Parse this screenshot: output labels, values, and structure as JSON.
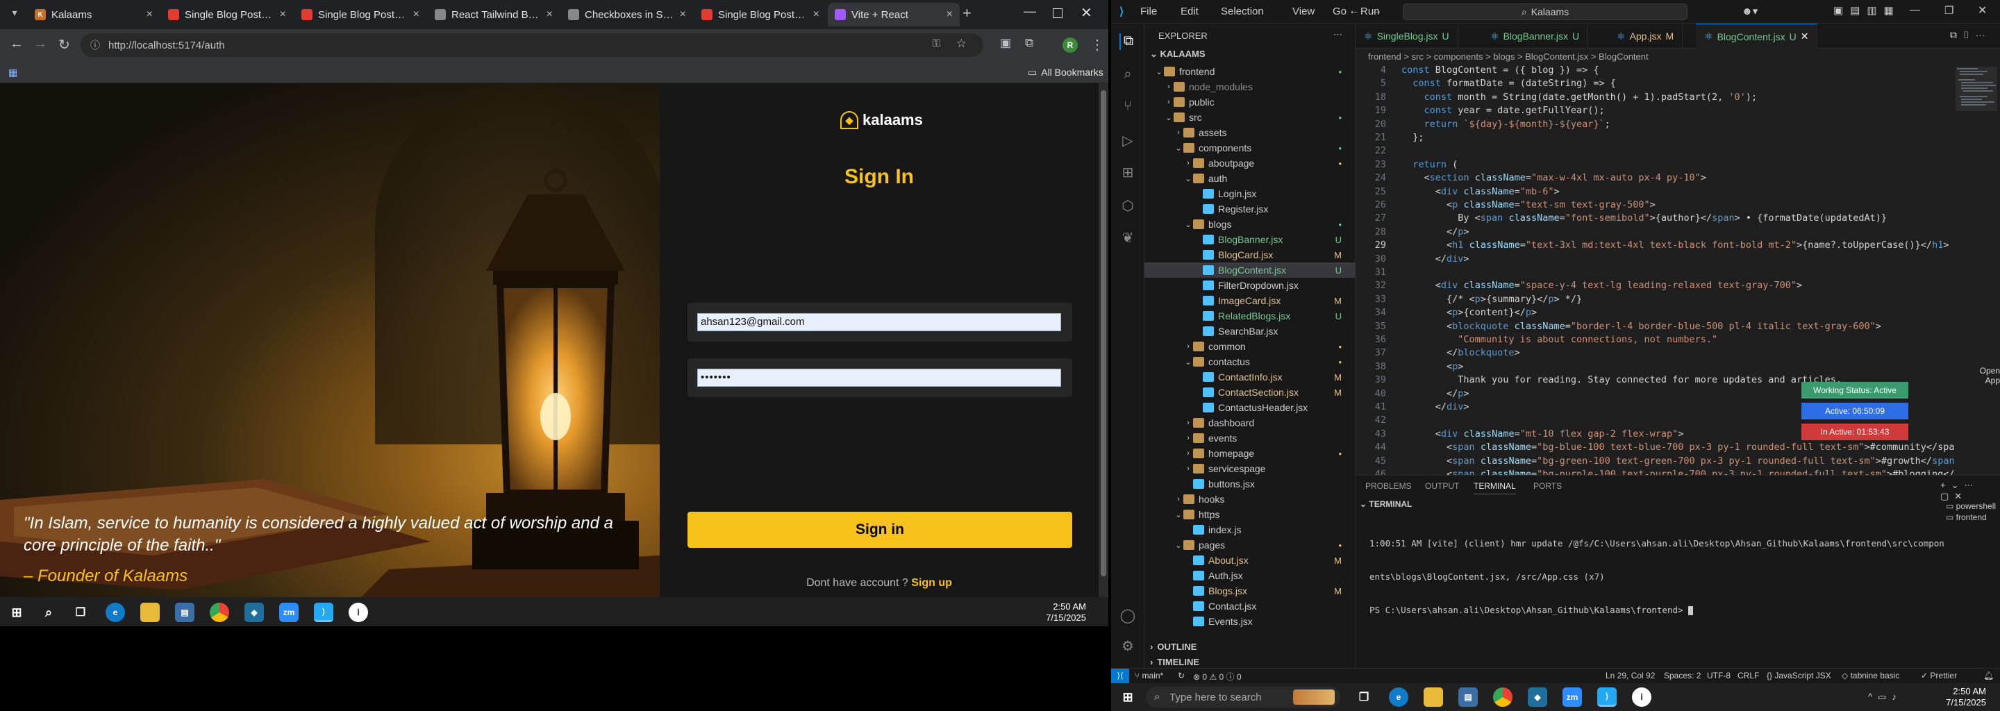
{
  "chrome": {
    "tabs": [
      {
        "title": "Kalaams",
        "active": false,
        "fav": "K",
        "fav_color": "#c4702a"
      },
      {
        "title": "Single Blog Posts Page",
        "active": false,
        "fav": "",
        "fav_color": "#e33b2e"
      },
      {
        "title": "Single Blog Posts Page",
        "active": false,
        "fav": "",
        "fav_color": "#e33b2e"
      },
      {
        "title": "React Tailwind Blog Co",
        "active": false,
        "fav": "",
        "fav_color": "#888"
      },
      {
        "title": "Checkboxes in Same R",
        "active": false,
        "fav": "",
        "fav_color": "#888"
      },
      {
        "title": "Single Blog Posts Page",
        "active": false,
        "fav": "",
        "fav_color": "#e33b2e"
      },
      {
        "title": "Vite + React",
        "active": true,
        "fav": "",
        "fav_color": "#a259ff"
      }
    ],
    "url": "http://localhost:5174/auth",
    "all_bookmarks": "All Bookmarks",
    "profile_initial": "R"
  },
  "auth_page": {
    "logo_text": "kalaams",
    "title": "Sign In",
    "email_value": "ahsan123@gmail.com",
    "password_value": "•••••••",
    "signin_button": "Sign in",
    "signup_prompt": "Dont have account ?",
    "signup_link": "Sign up",
    "quote": "\"In Islam, service to humanity is considered a highly valued act of worship and a core principle of the faith..\"",
    "attribution": "– Founder of Kalaams"
  },
  "taskbar_left": {
    "time": "2:50 AM",
    "date": "7/15/2025"
  },
  "vscode": {
    "menu": [
      "File",
      "Edit",
      "Selection",
      "View",
      "Go",
      "Run"
    ],
    "search": "Kalaams",
    "explorer_title": "EXPLORER",
    "workspace": "KALAAMS",
    "tree": [
      {
        "name": "frontend",
        "depth": 1,
        "type": "folder",
        "open": true,
        "badge": "•",
        "badge_color": "#73c991"
      },
      {
        "name": "node_modules",
        "depth": 2,
        "type": "folder",
        "open": false,
        "badge": "",
        "badge_color": "#888",
        "dim": true
      },
      {
        "name": "public",
        "depth": 2,
        "type": "folder",
        "open": false,
        "badge": "",
        "badge_color": ""
      },
      {
        "name": "src",
        "depth": 2,
        "type": "folder",
        "open": true,
        "badge": "•",
        "badge_color": "#73c991"
      },
      {
        "name": "assets",
        "depth": 3,
        "type": "folder",
        "open": false,
        "badge": "",
        "badge_color": ""
      },
      {
        "name": "components",
        "depth": 3,
        "type": "folder",
        "open": true,
        "badge": "•",
        "badge_color": "#73c991"
      },
      {
        "name": "aboutpage",
        "depth": 4,
        "type": "folder",
        "open": false,
        "badge": "•",
        "badge_color": "#e2c08d"
      },
      {
        "name": "auth",
        "depth": 4,
        "type": "folder",
        "open": true,
        "badge": "",
        "badge_color": ""
      },
      {
        "name": "Login.jsx",
        "depth": 5,
        "type": "file",
        "badge": "",
        "badge_color": ""
      },
      {
        "name": "Register.jsx",
        "depth": 5,
        "type": "file",
        "badge": "",
        "badge_color": ""
      },
      {
        "name": "blogs",
        "depth": 4,
        "type": "folder",
        "open": true,
        "badge": "•",
        "badge_color": "#73c991"
      },
      {
        "name": "BlogBanner.jsx",
        "depth": 5,
        "type": "file",
        "badge": "U",
        "badge_color": "#73c991"
      },
      {
        "name": "BlogCard.jsx",
        "depth": 5,
        "type": "file",
        "badge": "M",
        "badge_color": "#e2c08d"
      },
      {
        "name": "BlogContent.jsx",
        "depth": 5,
        "type": "file",
        "badge": "U",
        "badge_color": "#73c991",
        "selected": true
      },
      {
        "name": "FilterDropdown.jsx",
        "depth": 5,
        "type": "file",
        "badge": "",
        "badge_color": ""
      },
      {
        "name": "ImageCard.jsx",
        "depth": 5,
        "type": "file",
        "badge": "M",
        "badge_color": "#e2c08d"
      },
      {
        "name": "RelatedBlogs.jsx",
        "depth": 5,
        "type": "file",
        "badge": "U",
        "badge_color": "#73c991"
      },
      {
        "name": "SearchBar.jsx",
        "depth": 5,
        "type": "file",
        "badge": "",
        "badge_color": ""
      },
      {
        "name": "common",
        "depth": 4,
        "type": "folder",
        "open": false,
        "badge": "•",
        "badge_color": "#e2c08d"
      },
      {
        "name": "contactus",
        "depth": 4,
        "type": "folder",
        "open": true,
        "badge": "•",
        "badge_color": "#e2c08d"
      },
      {
        "name": "ContactInfo.jsx",
        "depth": 5,
        "type": "file",
        "badge": "M",
        "badge_color": "#e2c08d"
      },
      {
        "name": "ContactSection.jsx",
        "depth": 5,
        "type": "file",
        "badge": "M",
        "badge_color": "#e2c08d"
      },
      {
        "name": "ContactusHeader.jsx",
        "depth": 5,
        "type": "file",
        "badge": "",
        "badge_color": ""
      },
      {
        "name": "dashboard",
        "depth": 4,
        "type": "folder",
        "open": false,
        "badge": "",
        "badge_color": ""
      },
      {
        "name": "events",
        "depth": 4,
        "type": "folder",
        "open": false,
        "badge": "",
        "badge_color": ""
      },
      {
        "name": "homepage",
        "depth": 4,
        "type": "folder",
        "open": false,
        "badge": "•",
        "badge_color": "#e2c08d"
      },
      {
        "name": "servicespage",
        "depth": 4,
        "type": "folder",
        "open": false,
        "badge": "",
        "badge_color": ""
      },
      {
        "name": "buttons.jsx",
        "depth": 4,
        "type": "file",
        "badge": "",
        "badge_color": ""
      },
      {
        "name": "hooks",
        "depth": 3,
        "type": "folder",
        "open": false,
        "badge": "",
        "badge_color": ""
      },
      {
        "name": "https",
        "depth": 3,
        "type": "folder",
        "open": true,
        "badge": "",
        "badge_color": ""
      },
      {
        "name": "index.js",
        "depth": 4,
        "type": "file",
        "badge": "",
        "badge_color": ""
      },
      {
        "name": "pages",
        "depth": 3,
        "type": "folder",
        "open": true,
        "badge": "•",
        "badge_color": "#e2c08d"
      },
      {
        "name": "About.jsx",
        "depth": 4,
        "type": "file",
        "badge": "M",
        "badge_color": "#e2c08d"
      },
      {
        "name": "Auth.jsx",
        "depth": 4,
        "type": "file",
        "badge": "",
        "badge_color": ""
      },
      {
        "name": "Blogs.jsx",
        "depth": 4,
        "type": "file",
        "badge": "M",
        "badge_color": "#e2c08d"
      },
      {
        "name": "Contact.jsx",
        "depth": 4,
        "type": "file",
        "badge": "",
        "badge_color": ""
      },
      {
        "name": "Events.jsx",
        "depth": 4,
        "type": "file",
        "badge": "",
        "badge_color": ""
      }
    ],
    "outline": "OUTLINE",
    "timeline": "TIMELINE",
    "editor_tabs": [
      {
        "name": "SingleBlog.jsx",
        "badge": "U",
        "active": false
      },
      {
        "name": "BlogBanner.jsx",
        "badge": "U",
        "active": false
      },
      {
        "name": "App.jsx",
        "badge": "M",
        "active": false
      },
      {
        "name": "BlogContent.jsx",
        "badge": "U",
        "active": true
      }
    ],
    "breadcrumb": "frontend > src > components > blogs > BlogContent.jsx > BlogContent",
    "code_lines": [
      {
        "n": "4",
        "t": "const BlogContent = ({ blog }) => {"
      },
      {
        "n": "5",
        "t": "  const formatDate = (dateString) => {"
      },
      {
        "n": "18",
        "t": "    const month = String(date.getMonth() + 1).padStart(2, '0');"
      },
      {
        "n": "19",
        "t": "    const year = date.getFullYear();"
      },
      {
        "n": "20",
        "t": "    return `${day}-${month}-${year}`;"
      },
      {
        "n": "21",
        "t": "  };"
      },
      {
        "n": "22",
        "t": ""
      },
      {
        "n": "23",
        "t": "  return ("
      },
      {
        "n": "24",
        "t": "    <section className=\"max-w-4xl mx-auto px-4 py-10\">"
      },
      {
        "n": "25",
        "t": "      <div className=\"mb-6\">"
      },
      {
        "n": "26",
        "t": "        <p className=\"text-sm text-gray-500\">"
      },
      {
        "n": "27",
        "t": "          By <span className=\"font-semibold\">{author}</span> • {formatDate(updatedAt)}"
      },
      {
        "n": "28",
        "t": "        </p>"
      },
      {
        "n": "29",
        "t": "        <h1 className=\"text-3xl md:text-4xl text-black font-bold mt-2\">{name?.toUpperCase()}</h1>"
      },
      {
        "n": "30",
        "t": "      </div>"
      },
      {
        "n": "31",
        "t": ""
      },
      {
        "n": "32",
        "t": "      <div className=\"space-y-4 text-lg leading-relaxed text-gray-700\">"
      },
      {
        "n": "33",
        "t": "        {/* <p>{summary}</p> */}"
      },
      {
        "n": "34",
        "t": "        <p>{content}</p>"
      },
      {
        "n": "35",
        "t": "        <blockquote className=\"border-l-4 border-blue-500 pl-4 italic text-gray-600\">"
      },
      {
        "n": "36",
        "t": "          \"Community is about connections, not numbers.\""
      },
      {
        "n": "37",
        "t": "        </blockquote>"
      },
      {
        "n": "38",
        "t": "        <p>"
      },
      {
        "n": "39",
        "t": "          Thank you for reading. Stay connected for more updates and articles."
      },
      {
        "n": "40",
        "t": "        </p>"
      },
      {
        "n": "41",
        "t": "      </div>"
      },
      {
        "n": "42",
        "t": ""
      },
      {
        "n": "43",
        "t": "      <div className=\"mt-10 flex gap-2 flex-wrap\">"
      },
      {
        "n": "44",
        "t": "        <span className=\"bg-blue-100 text-blue-700 px-3 py-1 rounded-full text-sm\">#community</spa"
      },
      {
        "n": "45",
        "t": "        <span className=\"bg-green-100 text-green-700 px-3 py-1 rounded-full text-sm\">#growth</span"
      },
      {
        "n": "46",
        "t": "        <span className=\"bg-purple-100 text-purple-700 px-3 py-1 rounded-full text-sm\">#blogging</"
      }
    ],
    "widget": {
      "open_app": "Open App",
      "working_status": "Working Status: Active",
      "active": "Active: 06:50:09",
      "inactive": "In Active: 01:53:43"
    },
    "panel_tabs": [
      "PROBLEMS",
      "OUTPUT",
      "TERMINAL",
      "PORTS"
    ],
    "terminal_label": "TERMINAL",
    "terminal_shell": "powershell",
    "terminal_folder": "frontend",
    "terminal_lines": [
      "1:00:51 AM [vite] (client) hmr update /@fs/C:\\Users\\ahsan.ali\\Desktop\\Ahsan_Github\\Kalaams\\frontend\\src\\compon",
      "ents\\blogs\\BlogContent.jsx, /src/App.css (x7)",
      "PS C:\\Users\\ahsan.ali\\Desktop\\Ahsan_Github\\Kalaams\\frontend> "
    ],
    "status": {
      "branch": "main*",
      "problems": "⊗ 0 ⚠ 0 ⓘ 0",
      "position": "Ln 29, Col 92",
      "spaces": "Spaces: 2",
      "encoding": "UTF-8",
      "eol": "CRLF",
      "language": "JavaScript JSX",
      "tabnine": "tabnine basic",
      "prettier": "Prettier"
    }
  },
  "taskbar_right": {
    "search_placeholder": "Type here to search",
    "time": "2:50 AM",
    "date": "7/15/2025"
  },
  "colors": {
    "accent_gold": "#f7c21a",
    "vscode_blue": "#0078d4",
    "status_green": "#3a9b6e",
    "status_blue": "#2d6ee6",
    "status_red": "#d03a3a"
  }
}
